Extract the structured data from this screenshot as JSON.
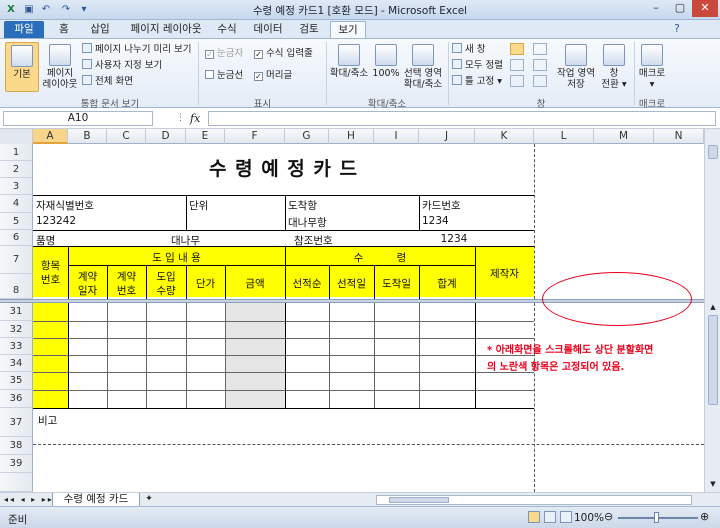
{
  "window": {
    "title": "수령 예정 카드1  [호환 모드]  -  Microsoft Excel"
  },
  "tabs": [
    "파일",
    "홈",
    "삽입",
    "페이지 레이아웃",
    "수식",
    "데이터",
    "검토",
    "보기"
  ],
  "ribbon": {
    "views": {
      "normal": "기본",
      "page_layout_1": "페이지",
      "page_layout_2": "레이아웃",
      "page_break": "페이지 나누기 미리 보기",
      "custom_views": "사용자 지정 보기",
      "full_screen": "전체 화면",
      "group": "통합 문서 보기"
    },
    "show": {
      "ruler": "눈금자",
      "formula_bar": "수식 입력줄",
      "gridlines": "눈금선",
      "headings": "머리글",
      "group": "표시"
    },
    "zoom": {
      "zoom": "확대/축소",
      "hundred": "100%",
      "selection_1": "선택 영역",
      "selection_2": "확대/축소",
      "group": "확대/축소"
    },
    "window": {
      "new_window": "새 창",
      "arrange_all": "모두 정렬",
      "freeze": "틀 고정",
      "save_ws_1": "작업 영역",
      "save_ws_2": "저장",
      "switch_1": "창",
      "switch_2": "전환",
      "group": "창"
    },
    "macros": {
      "label": "매크로",
      "group": "매크로"
    }
  },
  "formula_bar": {
    "name_box": "A10",
    "fx": "fx",
    "formula": ""
  },
  "columns": [
    "A",
    "B",
    "C",
    "D",
    "E",
    "F",
    "G",
    "H",
    "I",
    "J",
    "K",
    "L",
    "M",
    "N"
  ],
  "rows": [
    "1",
    "2",
    "3",
    "4",
    "5",
    "6",
    "7",
    "8",
    "31",
    "32",
    "33",
    "34",
    "35",
    "36",
    "37",
    "38",
    "39"
  ],
  "sheet": {
    "title": "수 령  예 정  카 드",
    "material_id_label": "자재식별번호",
    "material_id": "123242",
    "unit_label": "단위",
    "dest_label": "도착항",
    "dest_value": "대나무항",
    "card_no_label": "카드번호",
    "card_no": "1234",
    "item_label": "품명",
    "item_value": "대나무",
    "ref_label": "참조번호",
    "ref_value": "1234",
    "item_no_1": "항목",
    "item_no_2": "번호",
    "intro_header": "도 입 내 용",
    "contract_date_1": "계약",
    "contract_date_2": "일자",
    "contract_no_1": "계약",
    "contract_no_2": "번호",
    "intro_qty_1": "도입",
    "intro_qty_2": "수량",
    "unit_price": "단가",
    "amount": "금액",
    "receipt_header": "수          령",
    "ship_order": "선적순",
    "ship_date": "선적일",
    "arrival_date": "도착일",
    "total": "합계",
    "maker": "제작자",
    "remarks": "비고",
    "note_1": "* 아래화면을 스크롤해도 상단 분할화면",
    "note_2": "의 노란색 항목은 고정되어 있음."
  },
  "sheet_tab": "수령 예정 카드",
  "status": {
    "ready": "준비",
    "zoom": "100%"
  },
  "colors": {
    "yellow": "#ffff00",
    "note_red": "#e8001c",
    "excel_blue": "#2a6ebb"
  }
}
